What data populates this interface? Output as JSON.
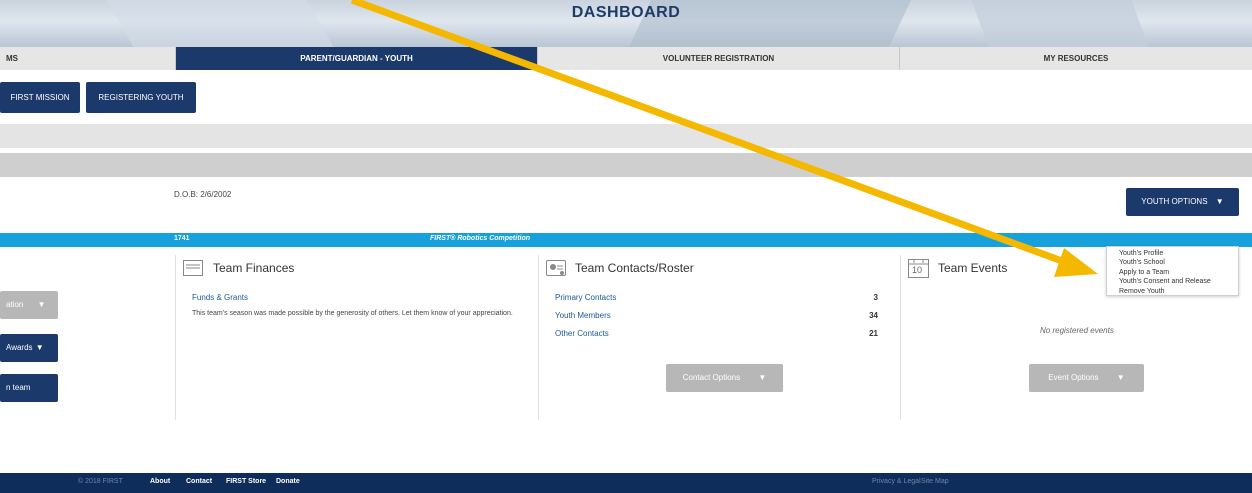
{
  "header": {
    "title": "DASHBOARD"
  },
  "tabs": [
    {
      "label": "MS"
    },
    {
      "label": "PARENT/GUARDIAN - YOUTH"
    },
    {
      "label": "VOLUNTEER REGISTRATION"
    },
    {
      "label": "MY RESOURCES"
    }
  ],
  "sub_buttons": {
    "first_mission": "FIRST MISSION",
    "registering_youth": "REGISTERING YOUTH"
  },
  "youth": {
    "dob": "D.O.B: 2/6/2002",
    "options_label": "YOUTH OPTIONS"
  },
  "team_band": {
    "number": "1741",
    "program": "FIRST® Robotics Competition"
  },
  "youth_menu": [
    "Youth's Profile",
    "Youth's School",
    "Apply to a Team",
    "Youth's Consent and Release",
    "Remove Youth"
  ],
  "left_buttons": {
    "gray": "ation",
    "awards": "Awards",
    "team": "n team"
  },
  "finances": {
    "title": "Team Finances",
    "link": "Funds & Grants",
    "text": "This team's season was made possible by the generosity of others. Let them know of your appreciation."
  },
  "contacts": {
    "title": "Team Contacts/Roster",
    "rows": [
      {
        "label": "Primary Contacts",
        "count": "3"
      },
      {
        "label": "Youth Members",
        "count": "34"
      },
      {
        "label": "Other Contacts",
        "count": "21"
      }
    ],
    "button": "Contact Options"
  },
  "events": {
    "title": "Team Events",
    "calendar_num": "10",
    "empty": "No registered events",
    "button": "Event Options"
  },
  "footer": {
    "copyright": "© 2018 FIRST",
    "about": "About",
    "contact": "Contact",
    "store": "FIRST Store",
    "donate": "Donate",
    "privacy": "Privacy & Legal",
    "sitemap": "Site Map"
  },
  "colors": {
    "navy": "#1b3a6b",
    "cyan": "#16a1dc",
    "arrow": "#f5b800"
  }
}
